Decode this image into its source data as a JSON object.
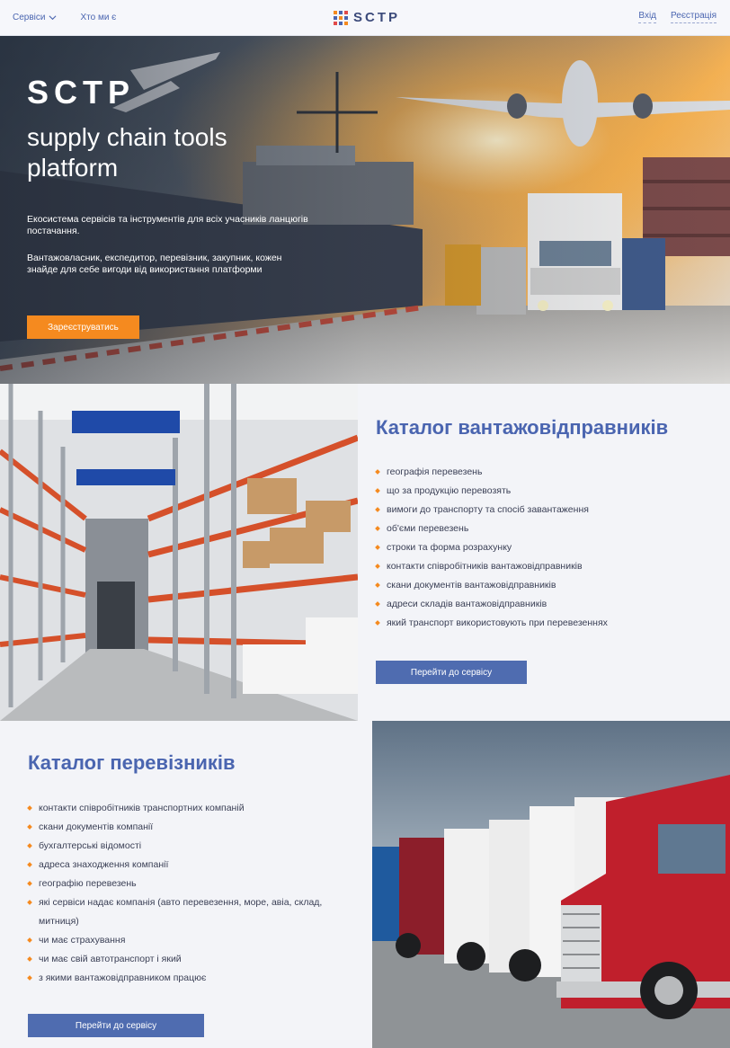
{
  "header": {
    "services_label": "Сервіси",
    "about_label": "Хто ми є",
    "logo_text": "SCTP",
    "login_label": "Вхід",
    "register_label": "Реєстрація"
  },
  "hero": {
    "title": "SCTP",
    "subtitle": "supply chain tools platform",
    "paragraph1": "Екосистема сервісів та інструментів для всіх учасників ланцюгів постачання.",
    "paragraph2": "Вантажовласник, експедитор, перевізник, закупник, кожен знайде для себе вигоди від використання платформи",
    "cta_label": "Зареєструватись"
  },
  "shippers_catalog": {
    "title": "Каталог вантажовідправників",
    "items": [
      "географія перевезень",
      "що за продукцію перевозять",
      "вимоги до транспорту та спосіб завантаження",
      "об'єми перевезень",
      "строки та форма розрахунку",
      "контакти співробітників вантажовідправників",
      "скани документів вантажовідправників",
      "адреси складів вантажовідправників",
      "який транспорт використовують при перевезеннях"
    ],
    "button_label": "Перейти до сервісу"
  },
  "carriers_catalog": {
    "title": "Каталог перевізників",
    "items": [
      "контакти співробітників транспортних компаній",
      "скани документів компанії",
      "бухгалтерські відомості",
      "адреса знаходження компанії",
      "географію перевезень",
      "які сервіси надає компанія (авто перевезення, море, авіа, склад, митниця)",
      "чи має страхування",
      "чи має свій автотранспорт і який",
      "з якими вантажовідправником працює"
    ],
    "button_label": "Перейти до сервісу"
  },
  "colors": {
    "accent_orange": "#f58a1f",
    "brand_blue": "#4a65b0",
    "button_blue": "#4f6cb0"
  }
}
